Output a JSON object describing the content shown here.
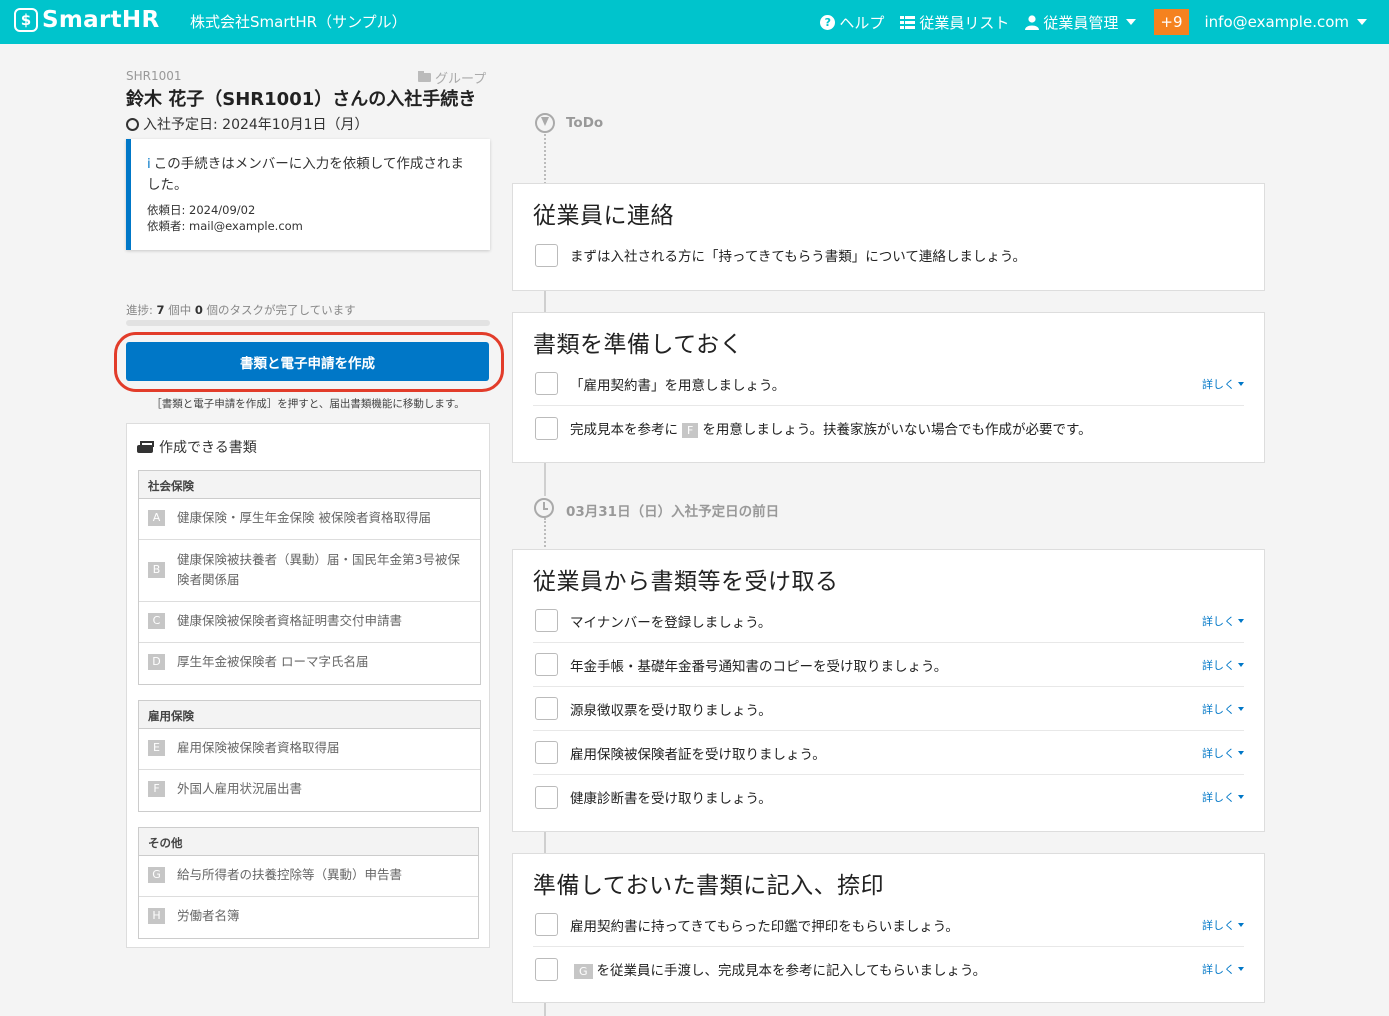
{
  "header": {
    "logo_text": "SmartHR",
    "company": "株式会社SmartHR（サンプル）",
    "nav": {
      "help": "ヘルプ",
      "employee_list": "従業員リスト",
      "employee_admin": "従業員管理",
      "notifications": "+9",
      "account": "info@example.com"
    }
  },
  "procedure": {
    "employee_code": "SHR1001",
    "group_label": "グループ",
    "title": "鈴木 花子（SHR1001）さんの入社手続き",
    "join_date": "入社予定日: 2024年10月1日（月）",
    "info": {
      "icon_text": "i",
      "message": "この手続きはメンバーに入力を依頼して作成されました。",
      "request_date": "依頼日: 2024/09/02",
      "requester": "依頼者: mail@example.com"
    },
    "progress": {
      "prefix": "進捗: ",
      "total": "7",
      "middle": " 個中 ",
      "done": "0",
      "suffix": " 個のタスクが完了しています",
      "fraction": 0
    },
    "create_button": "書類と電子申請を作成",
    "create_note": "［書類と電子申請を作成］を押すと、届出書類機能に移動します。"
  },
  "documents": {
    "heading": "作成できる書類",
    "groups": [
      {
        "title": "社会保険",
        "items": [
          {
            "letter": "A",
            "name": "健康保険・厚生年金保険 被保険者資格取得届"
          },
          {
            "letter": "B",
            "name": "健康保険被扶養者（異動）届・国民年金第3号被保険者関係届"
          },
          {
            "letter": "C",
            "name": "健康保険被保険者資格証明書交付申請書"
          },
          {
            "letter": "D",
            "name": "厚生年金被保険者 ローマ字氏名届"
          }
        ]
      },
      {
        "title": "雇用保険",
        "items": [
          {
            "letter": "E",
            "name": "雇用保険被保険者資格取得届"
          },
          {
            "letter": "F",
            "name": "外国人雇用状況届出書"
          }
        ]
      },
      {
        "title": "その他",
        "items": [
          {
            "letter": "G",
            "name": "給与所得者の扶養控除等（異動）申告書"
          },
          {
            "letter": "H",
            "name": "労働者名簿"
          }
        ]
      }
    ]
  },
  "timeline": {
    "todo_label": "ToDo",
    "milestone_label": "03月31日（日）入社予定日の前日",
    "detail_label": "詳しく",
    "cards": [
      {
        "title": "従業員に連絡",
        "tasks": [
          {
            "text": "まずは入社される方に「持ってきてもらう書類」について連絡しましょう。",
            "detail": false
          }
        ]
      },
      {
        "title": "書類を準備しておく",
        "tasks": [
          {
            "text": "「雇用契約書」を用意しましょう。",
            "detail": true
          },
          {
            "before": "完成見本を参考に",
            "tag": "F",
            "after": "を用意しましょう。扶養家族がいない場合でも作成が必要です。",
            "detail": false
          }
        ]
      },
      {
        "title": "従業員から書類等を受け取る",
        "tasks": [
          {
            "text": "マイナンバーを登録しましょう。",
            "detail": true
          },
          {
            "text": "年金手帳・基礎年金番号通知書のコピーを受け取りましょう。",
            "detail": true
          },
          {
            "text": "源泉徴収票を受け取りましょう。",
            "detail": true
          },
          {
            "text": "雇用保険被保険者証を受け取りましょう。",
            "detail": true
          },
          {
            "text": "健康診断書を受け取りましょう。",
            "detail": true
          }
        ]
      },
      {
        "title": "準備しておいた書類に記入、捺印",
        "tasks": [
          {
            "text": "雇用契約書に持ってきてもらった印鑑で押印をもらいましょう。",
            "detail": true
          },
          {
            "before": "",
            "tag": "G",
            "after": "を従業員に手渡し、完成見本を参考に記入してもらいましょう。",
            "detail": true
          }
        ]
      }
    ]
  },
  "colors": {
    "header": "#00c4cc",
    "primary": "#0077c7",
    "notification": "#f5821f",
    "highlight": "#e23c2a"
  }
}
